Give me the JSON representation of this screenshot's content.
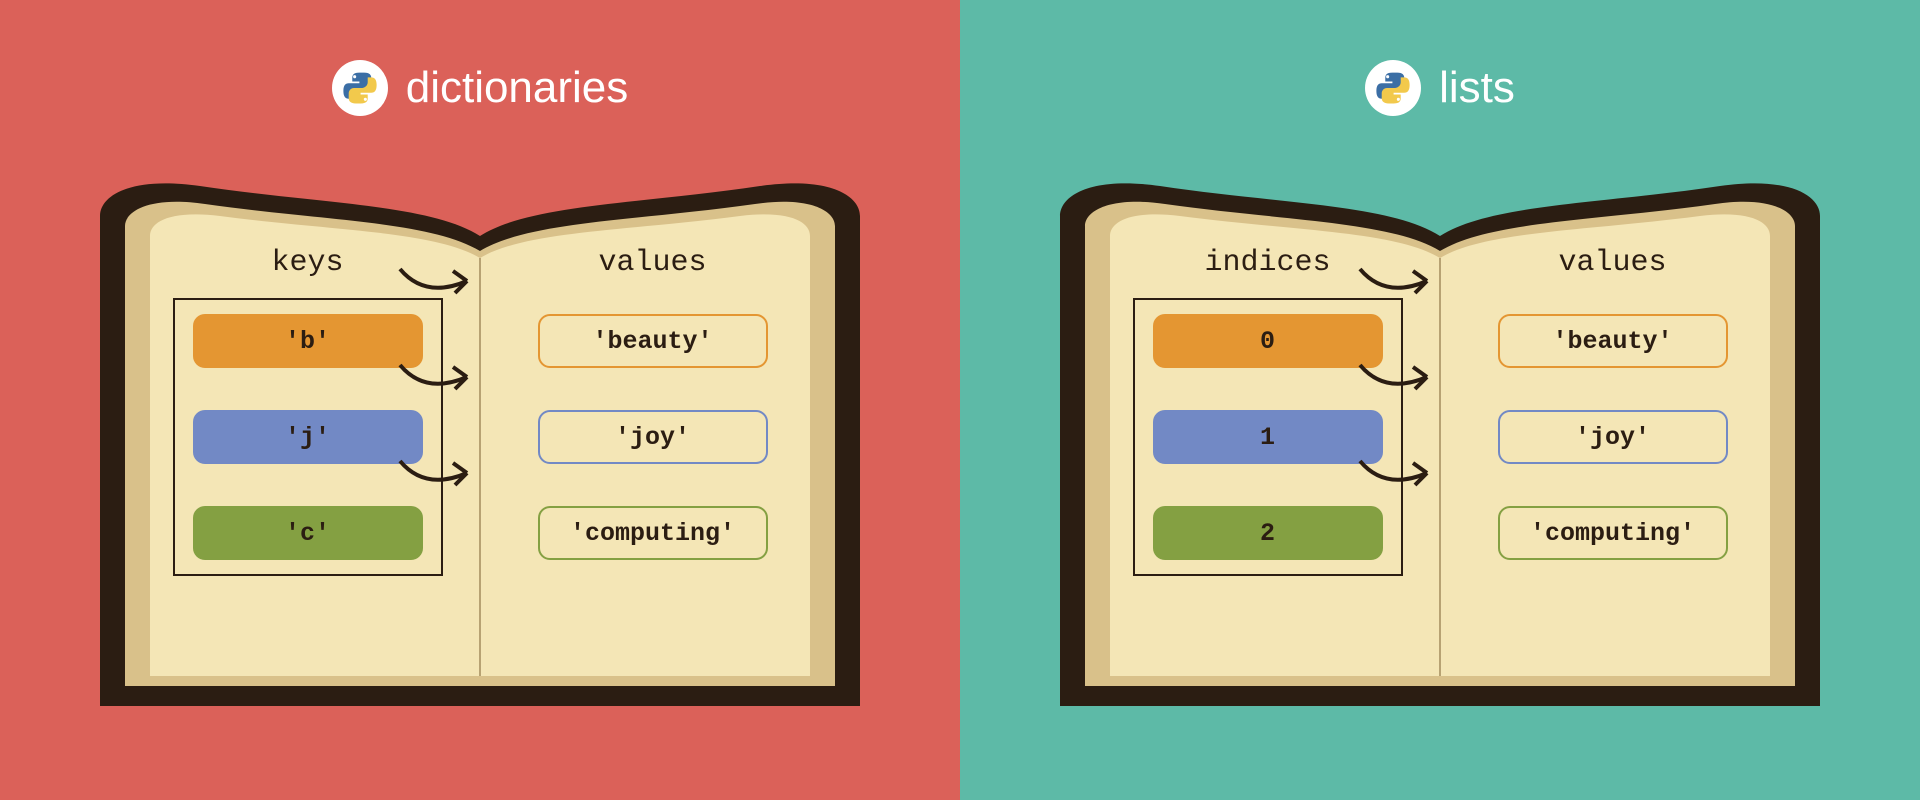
{
  "left": {
    "title": "dictionaries",
    "left_header": "keys",
    "right_header": "values",
    "rows": [
      {
        "key": "'b'",
        "value": "'beauty'"
      },
      {
        "key": "'j'",
        "value": "'joy'"
      },
      {
        "key": "'c'",
        "value": "'computing'"
      }
    ]
  },
  "right": {
    "title": "lists",
    "left_header": "indices",
    "right_header": "values",
    "rows": [
      {
        "key": "0",
        "value": "'beauty'"
      },
      {
        "key": "1",
        "value": "'joy'"
      },
      {
        "key": "2",
        "value": "'computing'"
      }
    ]
  },
  "colors": {
    "orange": "#e49632",
    "blue": "#7289c5",
    "green": "#84a042",
    "book_cover": "#2b1d12",
    "page": "#f4e6b6",
    "page_dark": "#d9c18a"
  }
}
